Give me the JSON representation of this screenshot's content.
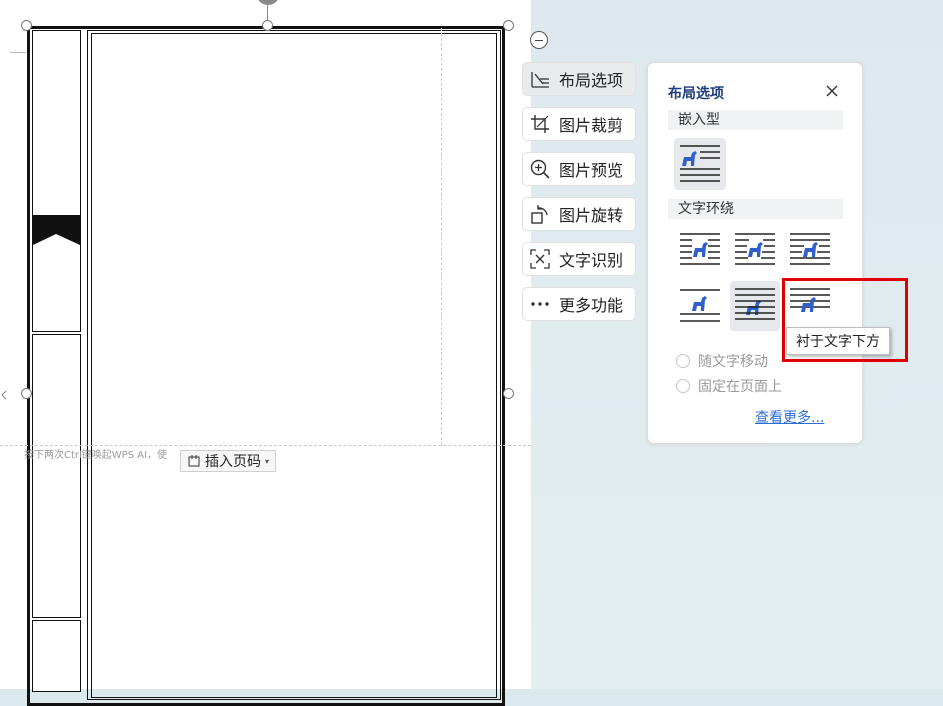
{
  "document": {
    "ai_hint": "按下两次Ctrl键唤起WPS AI，使",
    "insert_page_number": "插入页码"
  },
  "toolbar": {
    "items": [
      {
        "label": "布局选项",
        "icon": "layout-options-icon",
        "active": true
      },
      {
        "label": "图片裁剪",
        "icon": "crop-icon",
        "active": false
      },
      {
        "label": "图片预览",
        "icon": "zoom-preview-icon",
        "active": false
      },
      {
        "label": "图片旋转",
        "icon": "rotate-icon",
        "active": false
      },
      {
        "label": "文字识别",
        "icon": "ocr-icon",
        "active": false
      },
      {
        "label": "更多功能",
        "icon": "more-dots-icon",
        "active": false
      }
    ]
  },
  "layout_panel": {
    "title": "布局选项",
    "inline_section": "嵌入型",
    "wrap_section": "文字环绕",
    "selected_option": "behind-text",
    "tooltip": "衬于文字下方",
    "move_with_text": "随文字移动",
    "fix_on_page": "固定在页面上",
    "see_more": "查看更多..."
  },
  "colors": {
    "accent_blue": "#2f5fc9",
    "highlight_red": "#e00000",
    "panel_title": "#1f3c7a",
    "link": "#2b6fd6"
  }
}
